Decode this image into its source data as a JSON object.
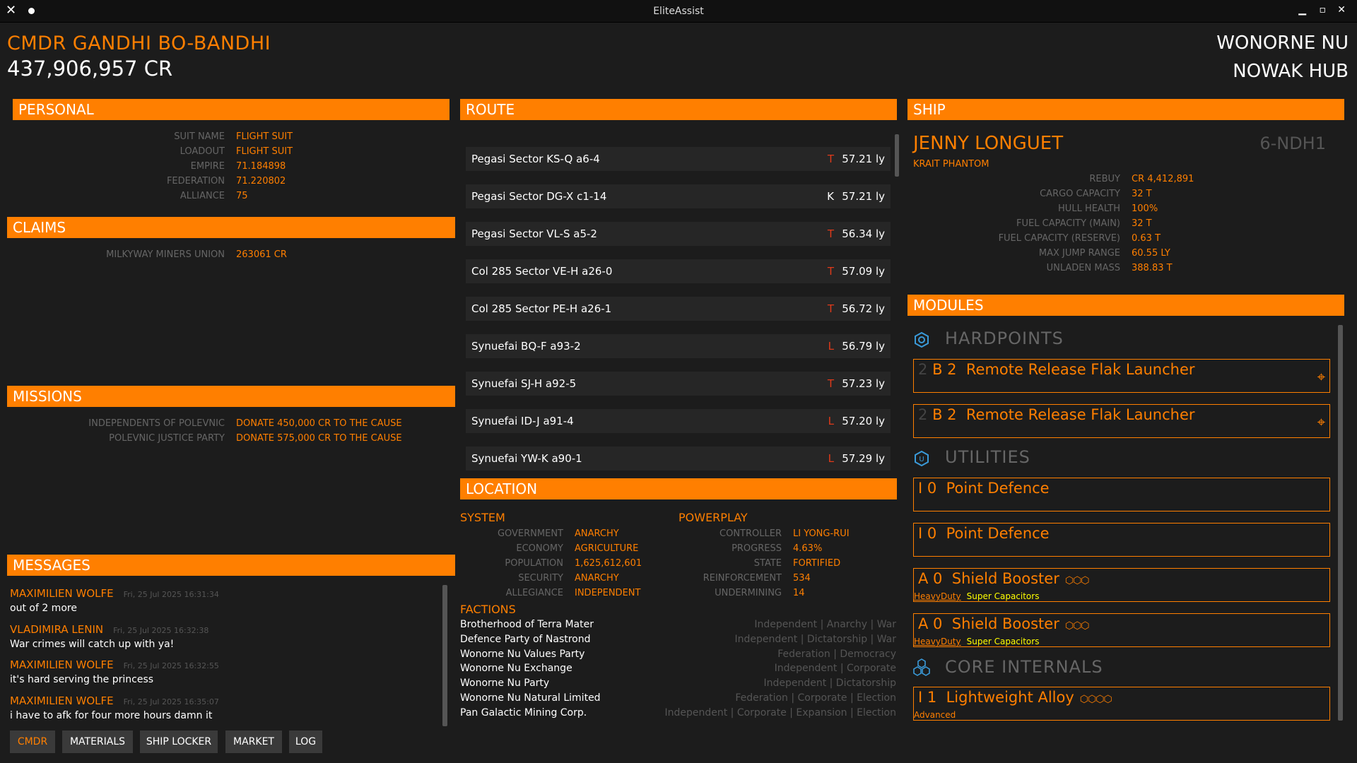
{
  "window": {
    "title": "EliteAssist"
  },
  "cmdr": {
    "name": "CMDR GANDHI BO-BANDHI",
    "credits": "437,906,957 CR"
  },
  "location_header": {
    "system": "WONORNE NU",
    "station": "NOWAK HUB"
  },
  "personal": {
    "title": "PERSONAL",
    "rows": [
      {
        "k": "SUIT NAME",
        "v": "FLIGHT SUIT"
      },
      {
        "k": "LOADOUT",
        "v": "FLIGHT SUIT"
      },
      {
        "k": "EMPIRE",
        "v": "71.184898"
      },
      {
        "k": "FEDERATION",
        "v": "71.220802"
      },
      {
        "k": "ALLIANCE",
        "v": "75"
      }
    ]
  },
  "claims": {
    "title": "CLAIMS",
    "rows": [
      {
        "k": "MILKYWAY MINERS UNION",
        "v": "263061 CR"
      }
    ]
  },
  "missions": {
    "title": "MISSIONS",
    "rows": [
      {
        "k": "INDEPENDENTS OF POLEVNIC",
        "v": "DONATE 450,000 CR TO THE CAUSE"
      },
      {
        "k": "POLEVNIC JUSTICE PARTY",
        "v": "DONATE 575,000 CR TO THE CAUSE"
      }
    ]
  },
  "messages": {
    "title": "MESSAGES",
    "items": [
      {
        "sender": "MAXIMILIEN WOLFE",
        "time": "Fri, 25 Jul 2025 16:31:34",
        "text": "out of 2 more"
      },
      {
        "sender": "VLADIMIRA LENIN",
        "time": "Fri, 25 Jul 2025 16:32:38",
        "text": "War crimes will catch up with ya!"
      },
      {
        "sender": "MAXIMILIEN WOLFE",
        "time": "Fri, 25 Jul 2025 16:32:55",
        "text": "it's hard serving the princess"
      },
      {
        "sender": "MAXIMILIEN WOLFE",
        "time": "Fri, 25 Jul 2025 16:35:07",
        "text": "i have to afk for four more hours damn it"
      }
    ]
  },
  "tabs": [
    "CMDR",
    "MATERIALS",
    "SHIP LOCKER",
    "MARKET",
    "LOG"
  ],
  "route": {
    "title": "ROUTE",
    "rows": [
      {
        "name": "Pegasi Sector KS-Q a6-4",
        "cls": "T",
        "dist": "57.21 ly"
      },
      {
        "name": "Pegasi Sector DG-X c1-14",
        "cls": "K",
        "dist": "57.21 ly"
      },
      {
        "name": "Pegasi Sector VL-S a5-2",
        "cls": "T",
        "dist": "56.34 ly"
      },
      {
        "name": "Col 285 Sector VE-H a26-0",
        "cls": "T",
        "dist": "57.09 ly"
      },
      {
        "name": "Col 285 Sector PE-H a26-1",
        "cls": "T",
        "dist": "56.72 ly"
      },
      {
        "name": "Synuefai BQ-F a93-2",
        "cls": "L",
        "dist": "56.79 ly"
      },
      {
        "name": "Synuefai SJ-H a92-5",
        "cls": "T",
        "dist": "57.23 ly"
      },
      {
        "name": "Synuefai ID-J a91-4",
        "cls": "L",
        "dist": "57.20 ly"
      },
      {
        "name": "Synuefai YW-K a90-1",
        "cls": "L",
        "dist": "57.29 ly"
      }
    ]
  },
  "location": {
    "title": "LOCATION",
    "system_label": "SYSTEM",
    "system_rows": [
      {
        "k": "GOVERNMENT",
        "v": "ANARCHY"
      },
      {
        "k": "ECONOMY",
        "v": "AGRICULTURE"
      },
      {
        "k": "POPULATION",
        "v": "1,625,612,601"
      },
      {
        "k": "SECURITY",
        "v": "ANARCHY"
      },
      {
        "k": "ALLEGIANCE",
        "v": "INDEPENDENT"
      }
    ],
    "powerplay_label": "POWERPLAY",
    "powerplay_rows": [
      {
        "k": "CONTROLLER",
        "v": "LI YONG-RUI"
      },
      {
        "k": "PROGRESS",
        "v": "4.63%"
      },
      {
        "k": "STATE",
        "v": "FORTIFIED"
      },
      {
        "k": "REINFORCEMENT",
        "v": "534"
      },
      {
        "k": "UNDERMINING",
        "v": "14"
      }
    ],
    "factions_label": "FACTIONS",
    "factions": [
      {
        "name": "Brotherhood of Terra Mater",
        "tags": "Independent | Anarchy | War"
      },
      {
        "name": "Defence Party of Nastrond",
        "tags": "Independent | Dictatorship | War"
      },
      {
        "name": "Wonorne Nu Values Party",
        "tags": "Federation | Democracy"
      },
      {
        "name": "Wonorne Nu Exchange",
        "tags": "Independent | Corporate"
      },
      {
        "name": "Wonorne Nu Party",
        "tags": "Independent | Dictatorship"
      },
      {
        "name": "Wonorne Nu Natural Limited",
        "tags": "Federation | Corporate | Election"
      },
      {
        "name": "Pan Galactic Mining Corp.",
        "tags": "Independent | Corporate | Expansion | Election"
      }
    ]
  },
  "ship": {
    "title": "SHIP",
    "name": "JENNY LONGUET",
    "ident": "6-NDH1",
    "type": "KRAIT PHANTOM",
    "rows": [
      {
        "k": "REBUY",
        "v": "CR 4,412,891"
      },
      {
        "k": "CARGO CAPACITY",
        "v": "32 T"
      },
      {
        "k": "HULL HEALTH",
        "v": "100%"
      },
      {
        "k": "FUEL CAPACITY (MAIN)",
        "v": "32 T"
      },
      {
        "k": "FUEL CAPACITY (RESERVE)",
        "v": "0.63 T"
      },
      {
        "k": "MAX JUMP RANGE",
        "v": "60.55 LY"
      },
      {
        "k": "UNLADEN MASS",
        "v": "388.83 T"
      }
    ]
  },
  "modules": {
    "title": "MODULES",
    "hardpoints_label": "HARDPOINTS",
    "utilities_label": "UTILITIES",
    "core_label": "CORE INTERNALS",
    "hardpoints": [
      {
        "prefix": "2",
        "code": "B 2",
        "name": "Remote Release Flak Launcher"
      },
      {
        "prefix": "2",
        "code": "B 2",
        "name": "Remote Release Flak Launcher"
      }
    ],
    "utilities": [
      {
        "code": "I 0",
        "name": "Point Defence",
        "blueprint": "",
        "experimental": ""
      },
      {
        "code": "I 0",
        "name": "Point Defence",
        "blueprint": "",
        "experimental": ""
      },
      {
        "code": "A 0",
        "name": "Shield Booster",
        "blueprint": "HeavyDuty",
        "experimental": "Super Capacitors"
      },
      {
        "code": "A 0",
        "name": "Shield Booster",
        "blueprint": "HeavyDuty",
        "experimental": "Super Capacitors"
      }
    ],
    "core": [
      {
        "code": "I 1",
        "name": "Lightweight Alloy",
        "blueprint": "Advanced"
      }
    ]
  }
}
